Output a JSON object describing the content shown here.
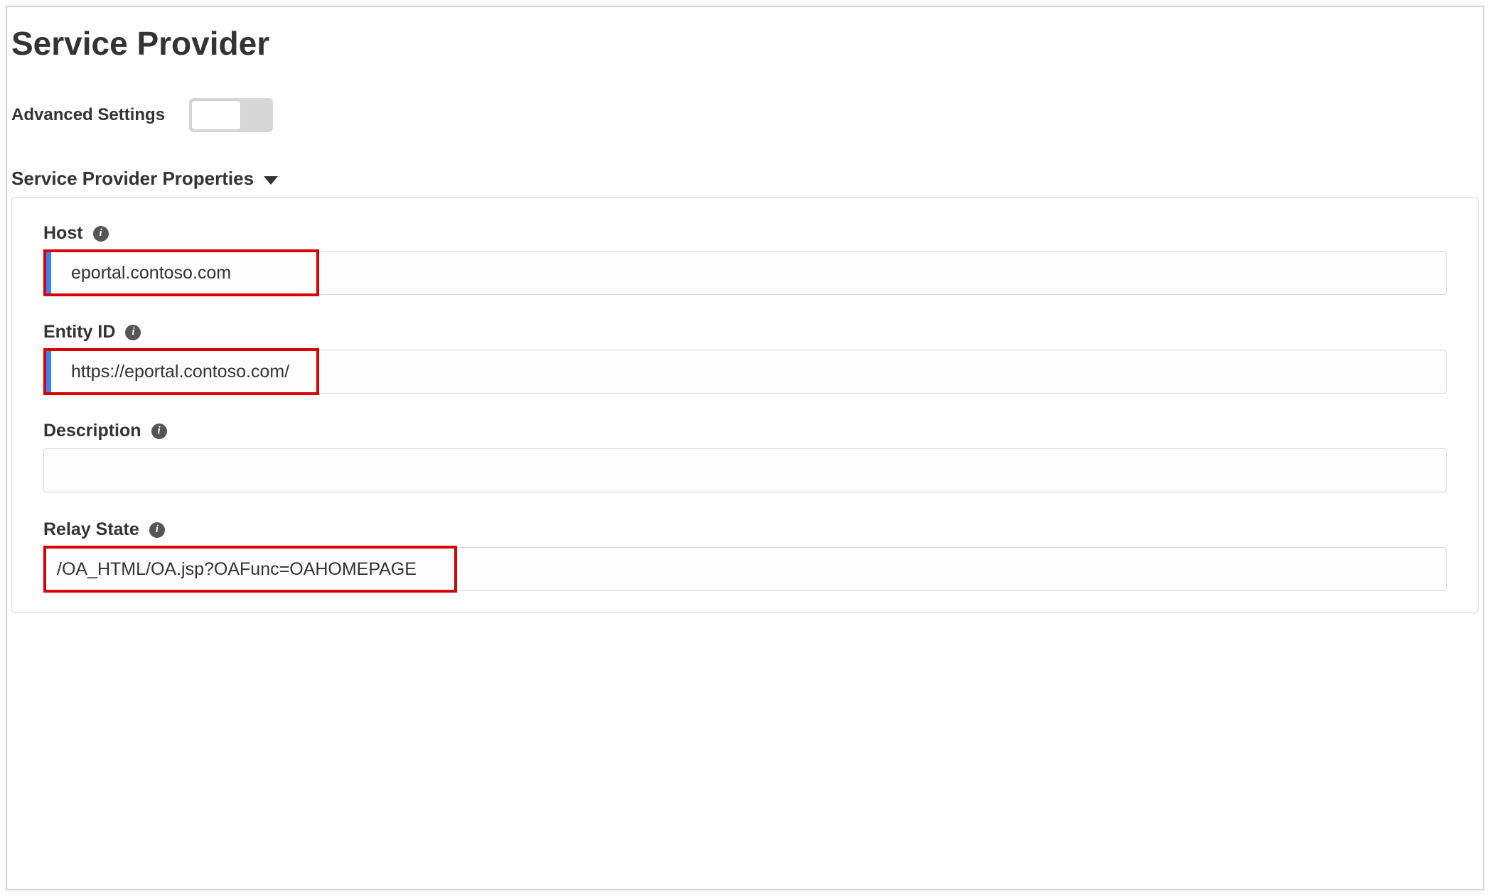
{
  "title": "Service Provider",
  "advanced": {
    "label": "Advanced Settings",
    "state": "off"
  },
  "section": {
    "header": "Service Provider Properties",
    "fields": {
      "host": {
        "label": "Host",
        "value": "eportal.contoso.com",
        "highlighted": true,
        "focused": true
      },
      "entity_id": {
        "label": "Entity ID",
        "value": "https://eportal.contoso.com/",
        "highlighted": true,
        "focused": true
      },
      "description": {
        "label": "Description",
        "value": "",
        "highlighted": false,
        "focused": false
      },
      "relay_state": {
        "label": "Relay State",
        "value": "/OA_HTML/OA.jsp?OAFunc=OAHOMEPAGE",
        "highlighted": true,
        "focused": false
      }
    }
  },
  "icons": {
    "info_glyph": "i"
  }
}
